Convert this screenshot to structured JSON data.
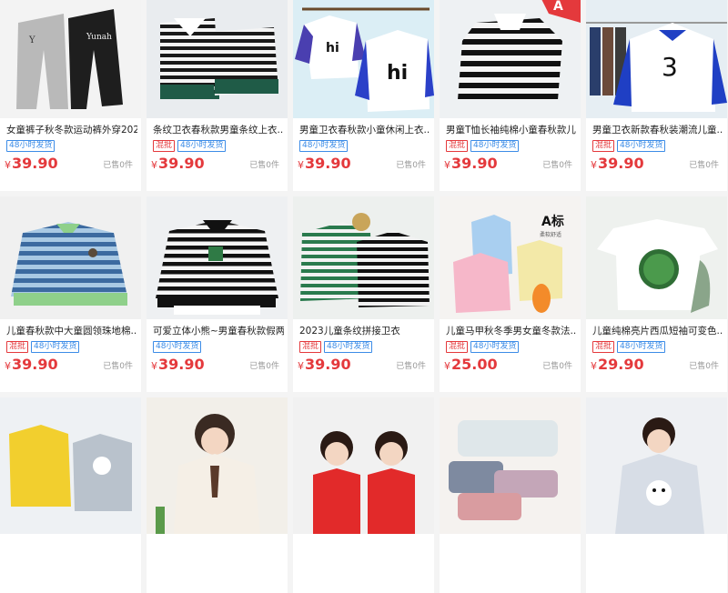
{
  "products": [
    {
      "title": "女童裤子秋冬款运动裤外穿202...",
      "tags": [
        "48小时发货"
      ],
      "tag_styles": [
        "blue"
      ],
      "currency": "¥",
      "price": "39.90",
      "sold": "已售0件",
      "image_text": "Yunah",
      "bg": "#f2f2f2"
    },
    {
      "title": "条纹卫衣春秋款男童条纹上衣...",
      "tags": [
        "混批",
        "48小时发货"
      ],
      "tag_styles": [
        "red",
        "blue"
      ],
      "currency": "¥",
      "price": "39.90",
      "sold": "已售0件",
      "image_text": "",
      "bg": "#e9ecef"
    },
    {
      "title": "男童卫衣春秋款小童休闲上衣...",
      "tags": [
        "48小时发货"
      ],
      "tag_styles": [
        "blue"
      ],
      "currency": "¥",
      "price": "39.90",
      "sold": "已售0件",
      "image_text": "hi",
      "bg": "#dbeef5"
    },
    {
      "title": "男童T恤长袖纯棉小童春秋款儿...",
      "tags": [
        "混批",
        "48小时发货"
      ],
      "tag_styles": [
        "red",
        "blue"
      ],
      "currency": "¥",
      "price": "39.90",
      "sold": "已售0件",
      "image_text": "A",
      "bg": "#eef1f3"
    },
    {
      "title": "男童卫衣新款春秋装潮流儿童...",
      "tags": [
        "混批",
        "48小时发货"
      ],
      "tag_styles": [
        "red",
        "blue"
      ],
      "currency": "¥",
      "price": "39.90",
      "sold": "已售0件",
      "image_text": "3",
      "bg": "#e6eef3"
    },
    {
      "title": "儿童春秋款中大童圆领珠地棉...",
      "tags": [
        "混批",
        "48小时发货"
      ],
      "tag_styles": [
        "red",
        "blue"
      ],
      "currency": "¥",
      "price": "39.90",
      "sold": "已售0件",
      "image_text": "",
      "bg": "#f0f0f0"
    },
    {
      "title": "可爱立体小熊~男童春秋款假两...",
      "tags": [
        "48小时发货"
      ],
      "tag_styles": [
        "blue"
      ],
      "currency": "¥",
      "price": "39.90",
      "sold": "已售0件",
      "image_text": "",
      "bg": "#eef0f2"
    },
    {
      "title": "2023儿童条纹拼接卫衣",
      "tags": [
        "混批",
        "48小时发货"
      ],
      "tag_styles": [
        "red",
        "blue"
      ],
      "currency": "¥",
      "price": "39.90",
      "sold": "已售0件",
      "image_text": "",
      "bg": "#edf0ee"
    },
    {
      "title": "儿童马甲秋冬季男女童冬款法...",
      "tags": [
        "混批",
        "48小时发货"
      ],
      "tag_styles": [
        "red",
        "blue"
      ],
      "currency": "¥",
      "price": "25.00",
      "sold": "已售0件",
      "image_text": "A标",
      "image_subtext": "柔软舒适",
      "bg": "#f5f3f1"
    },
    {
      "title": "儿童纯棉亮片西瓜短袖可变色...",
      "tags": [
        "混批",
        "48小时发货"
      ],
      "tag_styles": [
        "red",
        "blue"
      ],
      "currency": "¥",
      "price": "29.90",
      "sold": "已售0件",
      "image_text": "",
      "bg": "#eef1ee"
    },
    {
      "title": "",
      "tags": [],
      "tag_styles": [],
      "currency": "",
      "price": "",
      "sold": "",
      "image_text": "",
      "bg": "#eef1f4"
    },
    {
      "title": "",
      "tags": [],
      "tag_styles": [],
      "currency": "",
      "price": "",
      "sold": "",
      "image_text": "",
      "bg": "#f2efe9"
    },
    {
      "title": "",
      "tags": [],
      "tag_styles": [],
      "currency": "",
      "price": "",
      "sold": "",
      "image_text": "",
      "bg": "#f1f1f1"
    },
    {
      "title": "",
      "tags": [],
      "tag_styles": [],
      "currency": "",
      "price": "",
      "sold": "",
      "image_text": "",
      "bg": "#f5f2ef"
    },
    {
      "title": "",
      "tags": [],
      "tag_styles": [],
      "currency": "",
      "price": "",
      "sold": "",
      "image_text": "",
      "bg": "#eef0f3"
    }
  ],
  "colors": {
    "price": "#e4393c",
    "tag_red": "#e4393c",
    "tag_blue": "#3c8ce7"
  }
}
